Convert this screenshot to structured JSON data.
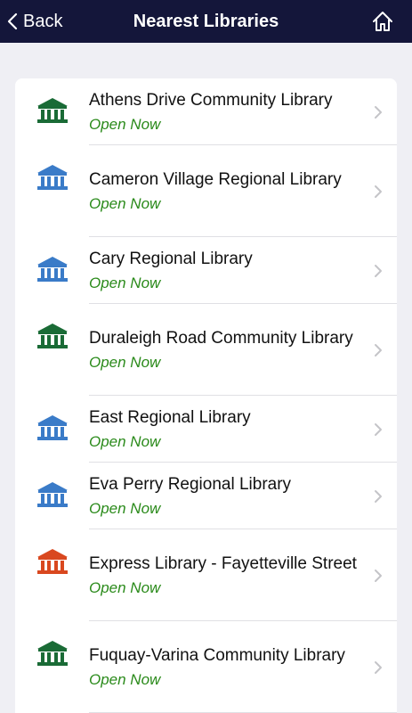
{
  "navbar": {
    "back_label": "Back",
    "title": "Nearest Libraries",
    "home_icon": "home-icon"
  },
  "colors": {
    "navbar_bg": "#14163a",
    "green": "#1a6b36",
    "blue": "#3a7bc8",
    "orange": "#d9481f",
    "status_green": "#2a8a1a"
  },
  "libraries": [
    {
      "name": "Athens Drive Community Library",
      "status": "Open Now",
      "icon_color": "#1a6b36"
    },
    {
      "name": "Cameron Village Regional Library",
      "status": "Open Now",
      "icon_color": "#3a7bc8"
    },
    {
      "name": "Cary Regional Library",
      "status": "Open Now",
      "icon_color": "#3a7bc8"
    },
    {
      "name": "Duraleigh Road Community Library",
      "status": "Open Now",
      "icon_color": "#1a6b36"
    },
    {
      "name": "East Regional Library",
      "status": "Open Now",
      "icon_color": "#3a7bc8"
    },
    {
      "name": "Eva Perry Regional Library",
      "status": "Open Now",
      "icon_color": "#3a7bc8"
    },
    {
      "name": "Express Library - Fayetteville Street",
      "status": "Open Now",
      "icon_color": "#d9481f"
    },
    {
      "name": "Fuquay-Varina Community Library",
      "status": "Open Now",
      "icon_color": "#1a6b36"
    }
  ]
}
